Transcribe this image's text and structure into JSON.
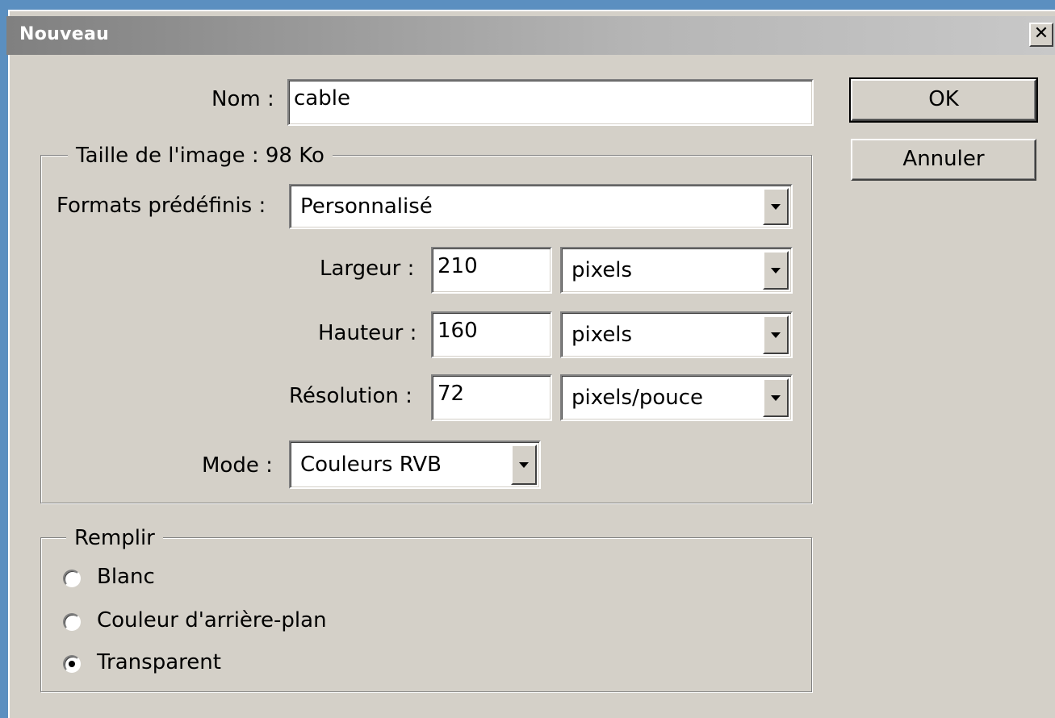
{
  "window": {
    "title": "Nouveau",
    "close_glyph": "✕"
  },
  "name": {
    "label": "Nom :",
    "value": "cable"
  },
  "image_size": {
    "legend": "Taille de l'image :  98 Ko",
    "presets": {
      "label": "Formats prédéfinis :",
      "value": "Personnalisé"
    },
    "width": {
      "label": "Largeur :",
      "value": "210",
      "unit": "pixels"
    },
    "height": {
      "label": "Hauteur :",
      "value": "160",
      "unit": "pixels"
    },
    "resolution": {
      "label": "Résolution :",
      "value": "72",
      "unit": "pixels/pouce"
    },
    "mode": {
      "label": "Mode :",
      "value": "Couleurs RVB"
    }
  },
  "fill": {
    "legend": "Remplir",
    "options": [
      {
        "label": "Blanc",
        "checked": false
      },
      {
        "label": "Couleur d'arrière-plan",
        "checked": false
      },
      {
        "label": "Transparent",
        "checked": true
      }
    ]
  },
  "buttons": {
    "ok": "OK",
    "cancel": "Annuler"
  },
  "icons": {
    "close": "close-icon",
    "dropdown": "chevron-down-icon",
    "radio": "radio-icon"
  }
}
